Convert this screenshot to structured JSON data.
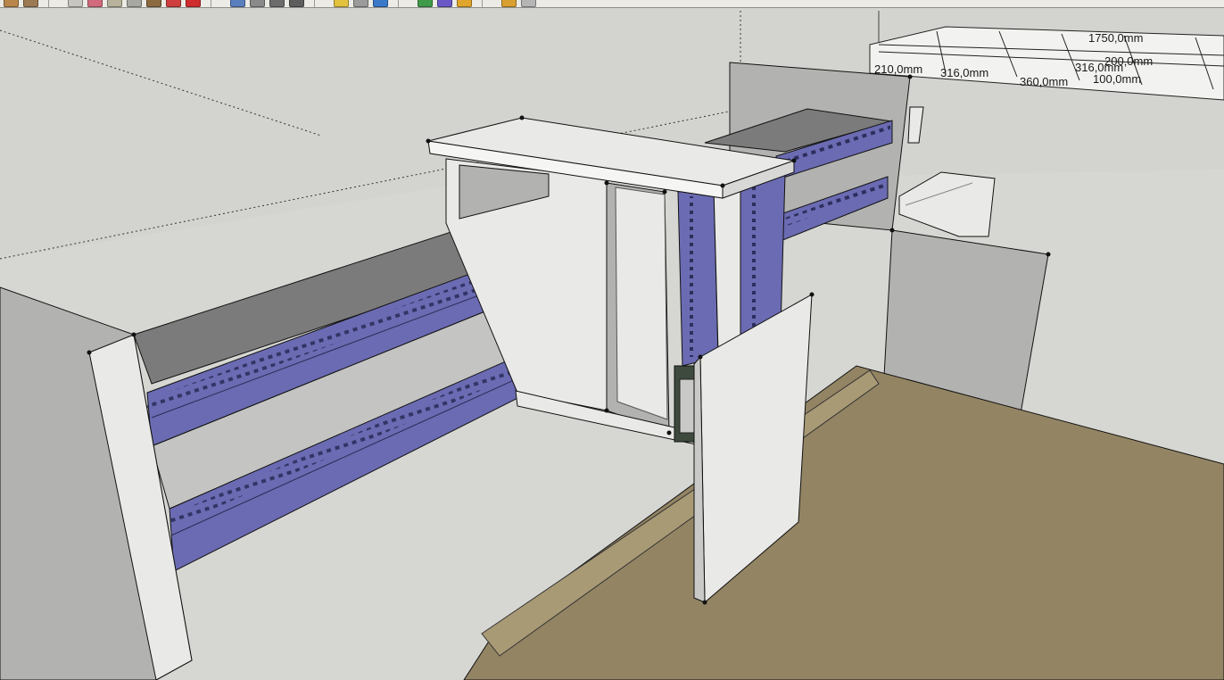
{
  "toolbar": {
    "tools": [
      {
        "icon": "select-arrow-icon",
        "color": "#b8864b"
      },
      {
        "icon": "component-icon",
        "color": "#9b7a55"
      },
      {
        "icon": "move-icon",
        "color": "#c7c5bf"
      },
      {
        "icon": "push-pull-icon",
        "color": "#d16a7d"
      },
      {
        "icon": "rotate-icon",
        "color": "#b7b29b"
      },
      {
        "icon": "scale-icon",
        "color": "#a8a8a2"
      },
      {
        "icon": "follow-me-icon",
        "color": "#8b6a3f"
      },
      {
        "icon": "offset-icon",
        "color": "#cf3e3e"
      },
      {
        "icon": "undo-icon",
        "color": "#cf2d2d"
      },
      {
        "icon": "orbit-icon",
        "color": "#5a7fbf"
      },
      {
        "icon": "pan-icon",
        "color": "#8a8a8a"
      },
      {
        "icon": "zoom-icon",
        "color": "#6c6c6c"
      },
      {
        "icon": "zoom-window-icon",
        "color": "#5d5d5d"
      },
      {
        "icon": "walk-icon",
        "color": "#e2c23e"
      },
      {
        "icon": "look-around-icon",
        "color": "#9b9b9b"
      },
      {
        "icon": "section-plane-icon",
        "color": "#3a78c9"
      },
      {
        "icon": "dimension-icon",
        "color": "#3f9a4a"
      },
      {
        "icon": "protractor-icon",
        "color": "#6b58c7"
      },
      {
        "icon": "tape-measure-icon",
        "color": "#e0a52a"
      },
      {
        "icon": "text-icon",
        "color": "#d8a030"
      },
      {
        "icon": "axes-icon",
        "color": "#b5b5b5"
      }
    ]
  },
  "model": {
    "colors": {
      "sky": "#d3d3cf",
      "floor": "#d6d7d2",
      "tabletop": "#938463",
      "side_panel": "#b2b2b0",
      "white_face": "#e9e9e7",
      "dark_face": "#7b7b7b",
      "rail": "#6b6bb3",
      "rail_dark": "#4d4d8a",
      "motor": "#3d4a3d",
      "edge": "#111111"
    }
  },
  "dimensions": [
    {
      "text": "1750,0mm"
    },
    {
      "text": "200,0mm"
    },
    {
      "text": "316,0mm"
    },
    {
      "text": "210,0mm"
    },
    {
      "text": "316,0mm"
    },
    {
      "text": "360,0mm"
    },
    {
      "text": "100,0mm"
    }
  ]
}
